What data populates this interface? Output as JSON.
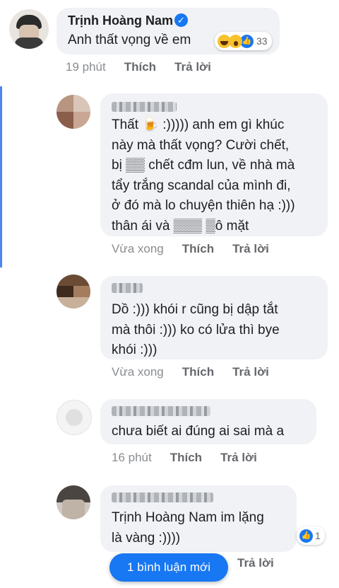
{
  "comments": [
    {
      "author": "Trịnh Hoàng Nam",
      "verified": true,
      "text": "Anh thất vọng về em",
      "time": "19 phút",
      "like": "Thích",
      "reply": "Trả lời",
      "reactions": {
        "icons": [
          "haha-emoji",
          "wow-emoji",
          "like-icon"
        ],
        "count": "33"
      }
    },
    {
      "author_blurred": true,
      "text": "Thất 🍺 :))))) anh em gì khúc\nnày mà thất vọng? Cười chết,\nbị ▒▒ chết cđm lun, về nhà mà\ntẩy trắng scandal của mình đi,\nở đó mà lo chuyện thiên hạ :)))\nthân ái và ▒▒▒ ▒ô mặt",
      "time": "Vừa xong",
      "like": "Thích",
      "reply": "Trả lời"
    },
    {
      "author_blurred": true,
      "text": "Dồ :))) khói r cũng bị dập tắt\nmà thôi :))) ko có lửa thì bye\nkhói :)))",
      "time": "Vừa xong",
      "like": "Thích",
      "reply": "Trả lời"
    },
    {
      "author_blurred": true,
      "text": "chưa biết ai đúng ai sai mà a",
      "time": "16 phút",
      "like": "Thích",
      "reply": "Trả lời"
    },
    {
      "author_blurred": true,
      "text": "Trịnh Hoàng Nam im lặng\nlà vàng :))))",
      "reply": "Trả lời",
      "reactions": {
        "icons": [
          "like-icon"
        ],
        "count": "1"
      }
    }
  ],
  "new_comments_button": "1 bình luận mới",
  "colors": {
    "accent": "#1877f2",
    "bubble": "#f0f2f5",
    "thread": "#4d86f0"
  }
}
